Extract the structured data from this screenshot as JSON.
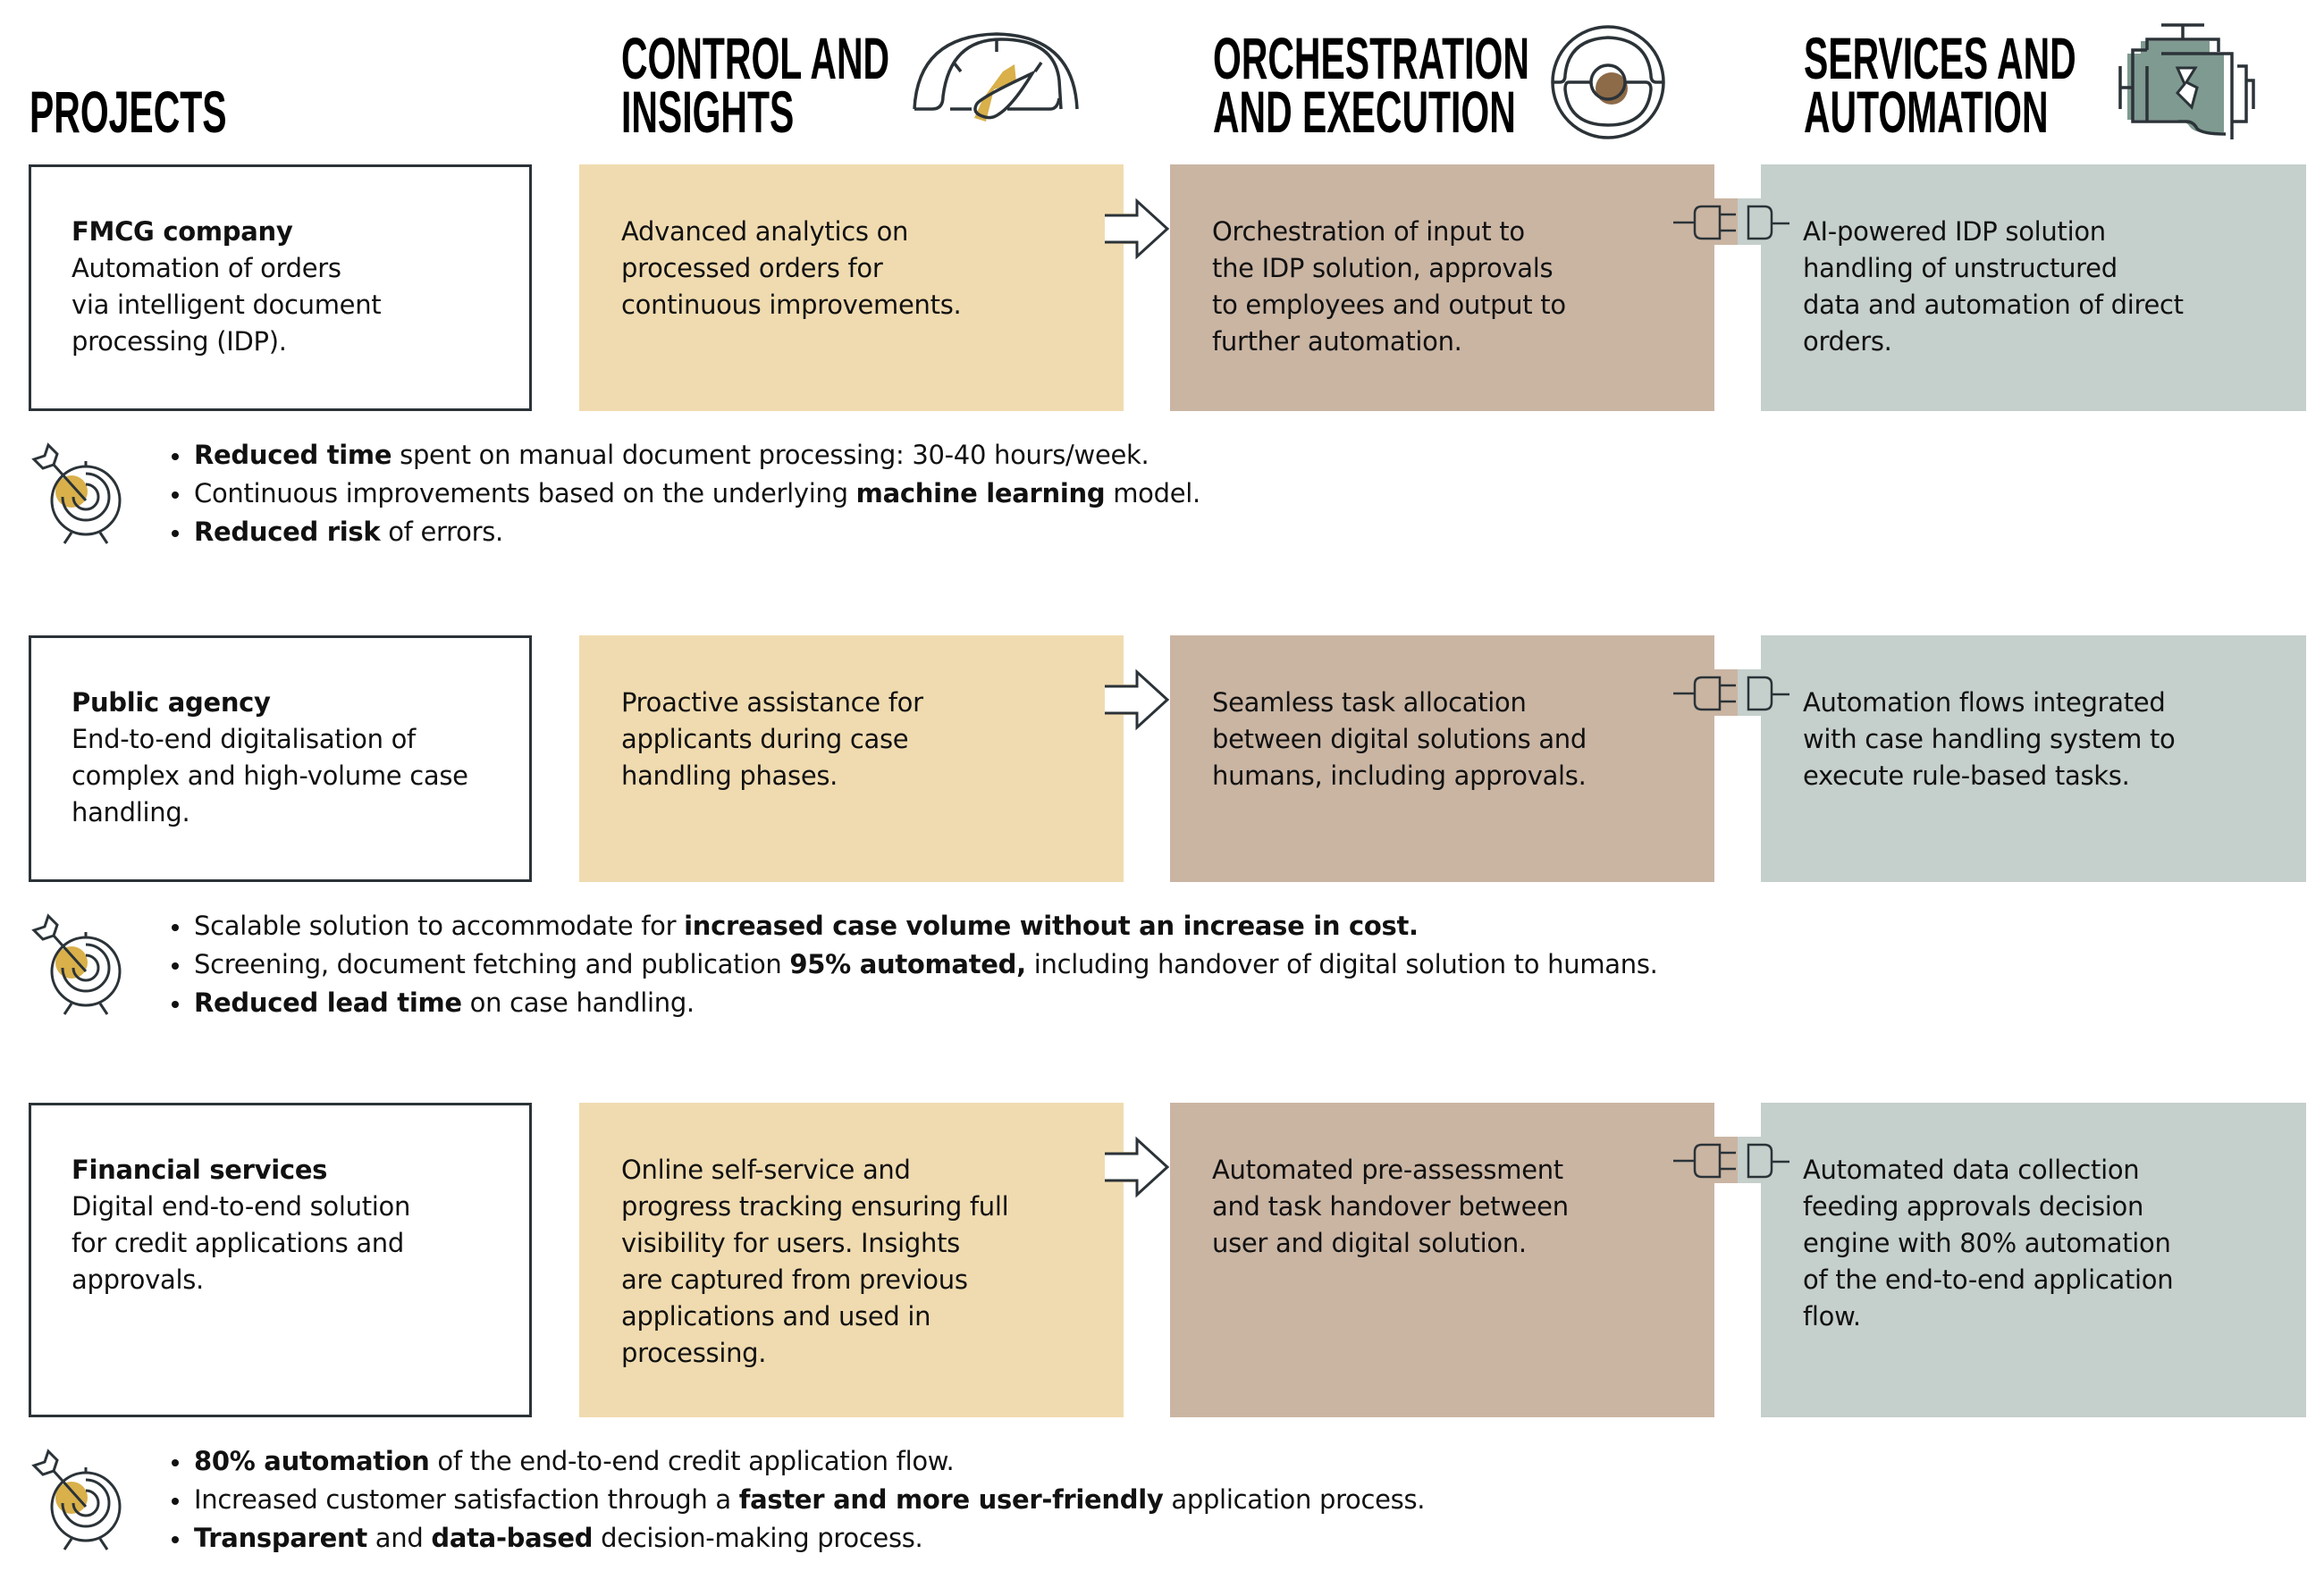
{
  "headers": {
    "projects": [
      "PROJECTS"
    ],
    "control": [
      "CONTROL AND",
      "INSIGHTS"
    ],
    "orchestration": [
      "ORCHESTRATION",
      "AND EXECUTION"
    ],
    "services": [
      "SERVICES AND",
      "AUTOMATION"
    ]
  },
  "icons": {
    "control": "speedometer-gauge-icon",
    "orchestration": "steering-wheel-icon",
    "services": "engine-icon",
    "arrow": "arrow-right-icon",
    "connector": "plug-socket-icon",
    "outcomes": "target-dart-icon"
  },
  "colors": {
    "control": "#f0dbb0",
    "orchestration": "#cab5a3",
    "services": "#c5cfcb",
    "accent_gold": "#d9b04a",
    "accent_brown": "#8d6a48",
    "accent_green": "#7f9a90",
    "outline": "#2b3338"
  },
  "rows": [
    {
      "project": {
        "title": "FMCG company",
        "lines": [
          "Automation of orders",
          "via intelligent document",
          "processing (IDP)."
        ]
      },
      "control": [
        "Advanced analytics on",
        "processed orders for",
        "continuous improvements."
      ],
      "orchestration": [
        "Orchestration of input to",
        "the IDP solution, approvals",
        "to employees and output to",
        "further automation."
      ],
      "services": [
        "AI-powered IDP solution",
        "handling of unstructured",
        "data and automation of direct",
        "orders."
      ],
      "outcomes": [
        [
          {
            "t": "Reduced time",
            "b": true
          },
          {
            "t": " spent on manual document processing: 30-40 hours/week.",
            "b": false
          }
        ],
        [
          {
            "t": "Continuous improvements based on the underlying ",
            "b": false
          },
          {
            "t": "machine learning",
            "b": true
          },
          {
            "t": " model.",
            "b": false
          }
        ],
        [
          {
            "t": "Reduced risk",
            "b": true
          },
          {
            "t": " of errors.",
            "b": false
          }
        ]
      ]
    },
    {
      "project": {
        "title": "Public agency",
        "lines": [
          "End-to-end digitalisation of",
          "complex and high-volume case",
          "handling."
        ]
      },
      "control": [
        "Proactive assistance for",
        "applicants during case",
        "handling phases."
      ],
      "orchestration": [
        "Seamless task allocation",
        "between digital solutions and",
        "humans, including approvals."
      ],
      "services": [
        "Automation flows integrated",
        "with case handling system to",
        "execute rule-based tasks."
      ],
      "outcomes": [
        [
          {
            "t": "Scalable solution to accommodate for ",
            "b": false
          },
          {
            "t": "increased case volume without an increase in cost.",
            "b": true
          }
        ],
        [
          {
            "t": "Screening, document fetching and publication ",
            "b": false
          },
          {
            "t": "95% automated,",
            "b": true
          },
          {
            "t": " including handover of digital solution to humans.",
            "b": false
          }
        ],
        [
          {
            "t": "Reduced lead time",
            "b": true
          },
          {
            "t": " on case handling.",
            "b": false
          }
        ]
      ]
    },
    {
      "project": {
        "title": "Financial services",
        "lines": [
          "Digital end-to-end solution",
          "for credit applications and",
          "approvals."
        ]
      },
      "control": [
        "Online self-service and",
        "progress tracking ensuring full",
        "visibility for users. Insights",
        "are captured from previous",
        "applications and used in",
        "processing."
      ],
      "orchestration": [
        "Automated pre-assessment",
        "and task handover between",
        "user and digital solution."
      ],
      "services": [
        "Automated data collection",
        "feeding approvals decision",
        "engine with 80% automation",
        "of the end-to-end application",
        "flow."
      ],
      "outcomes": [
        [
          {
            "t": "80% automation",
            "b": true
          },
          {
            "t": " of the end-to-end credit application flow.",
            "b": false
          }
        ],
        [
          {
            "t": "Increased customer satisfaction through a ",
            "b": false
          },
          {
            "t": "faster and more user-friendly",
            "b": true
          },
          {
            "t": " application process.",
            "b": false
          }
        ],
        [
          {
            "t": "Transparent",
            "b": true
          },
          {
            "t": " and ",
            "b": false
          },
          {
            "t": "data-based",
            "b": true
          },
          {
            "t": " decision-making process.",
            "b": false
          }
        ]
      ]
    }
  ]
}
